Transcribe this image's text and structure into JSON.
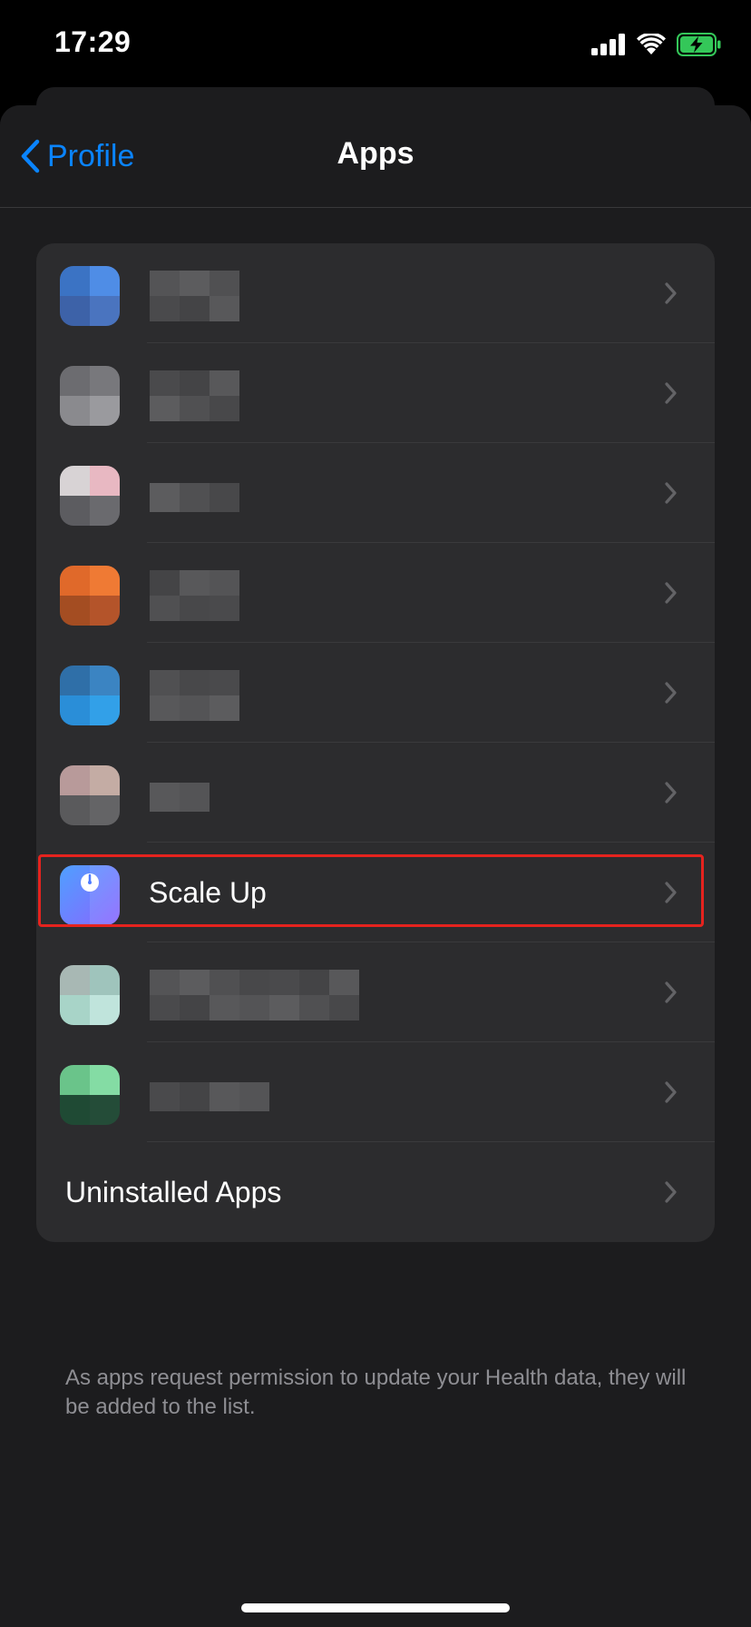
{
  "status_bar": {
    "time": "17:29",
    "icons": [
      "cellular-signal-icon",
      "wifi-icon",
      "battery-charging-icon"
    ],
    "battery_color": "#34c759"
  },
  "nav": {
    "back_label": "Profile",
    "title": "Apps"
  },
  "apps": [
    {
      "name": "",
      "obscured": true,
      "icon_colors": [
        "#3b73c4",
        "#4f8de6",
        "#3d62a8",
        "#4a74bf"
      ],
      "label_rows": 2,
      "label_cols": 3
    },
    {
      "name": "",
      "obscured": true,
      "icon_colors": [
        "#6c6c70",
        "#78787c",
        "#8a8a8e",
        "#9a9a9e"
      ],
      "label_rows": 2,
      "label_cols": 3
    },
    {
      "name": "",
      "obscured": true,
      "icon_colors": [
        "#d8d3d5",
        "#e8b8c2",
        "#5c5c60",
        "#6a6a6e"
      ],
      "label_rows": 1,
      "label_cols": 3
    },
    {
      "name": "",
      "obscured": true,
      "icon_colors": [
        "#e0692a",
        "#ef7a34",
        "#a44d22",
        "#b4542a"
      ],
      "label_rows": 2,
      "label_cols": 3
    },
    {
      "name": "",
      "obscured": true,
      "icon_colors": [
        "#2f6fa8",
        "#3b84c2",
        "#2a8ed8",
        "#32a0e8"
      ],
      "label_rows": 2,
      "label_cols": 3
    },
    {
      "name": "",
      "obscured": true,
      "icon_colors": [
        "#b89a9a",
        "#c4aca4",
        "#5a5a5c",
        "#646466"
      ],
      "label_rows": 1,
      "label_cols": 2
    },
    {
      "name": "Scale Up",
      "obscured": false,
      "highlighted": true,
      "icon_colors": [
        "#4fa0ff",
        "#8a64ff"
      ]
    },
    {
      "name": "",
      "obscured": true,
      "icon_colors": [
        "#a8b8b4",
        "#9fc4bc",
        "#a8d4c8",
        "#c0e4dc"
      ],
      "label_rows": 2,
      "label_cols": 7
    },
    {
      "name": "",
      "obscured": true,
      "icon_colors": [
        "#6ac48a",
        "#84dca4",
        "#1f4a34",
        "#244c38"
      ],
      "label_rows": 1,
      "label_cols": 4
    }
  ],
  "uninstalled": {
    "label": "Uninstalled Apps"
  },
  "footer": {
    "note": "As apps request permission to update your Health data, they will be added to the list."
  },
  "colors": {
    "accent": "#0a84ff",
    "highlight": "#e5231e",
    "background": "#1c1c1e",
    "cell": "#2c2c2e"
  }
}
